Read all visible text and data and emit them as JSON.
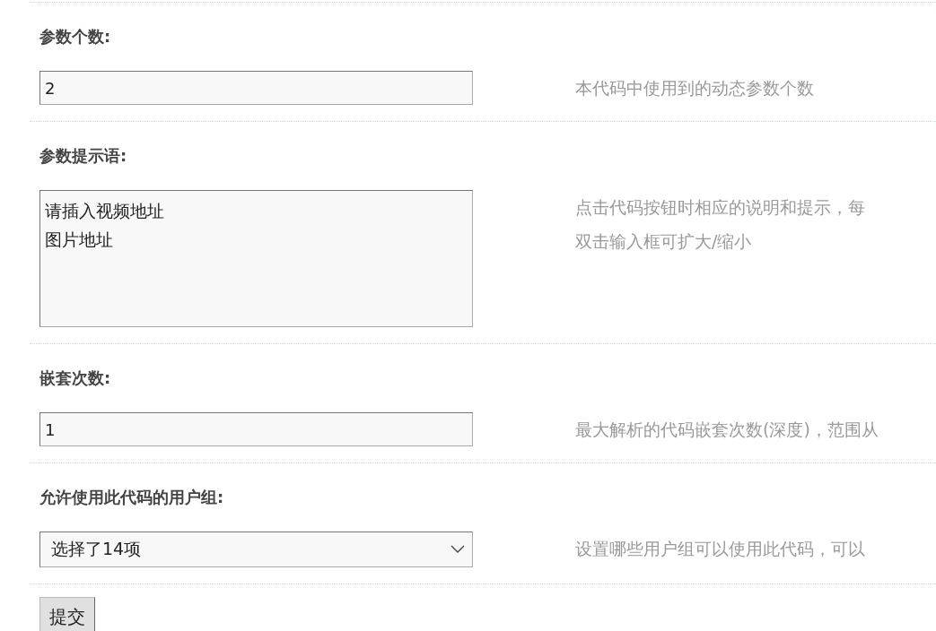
{
  "fields": [
    {
      "label": "参数个数:",
      "kind": "text",
      "value": "2",
      "description": [
        "本代码中使用到的动态参数个数"
      ]
    },
    {
      "label": "参数提示语:",
      "kind": "textarea",
      "lines": [
        "请插入视频地址",
        "图片地址"
      ],
      "description": [
        "点击代码按钮时相应的说明和提示，每",
        "双击输入框可扩大/缩小"
      ]
    },
    {
      "label": "嵌套次数:",
      "kind": "text",
      "value": "1",
      "description": [
        "最大解析的代码嵌套次数(深度)，范围从"
      ]
    },
    {
      "label": "允许使用此代码的用户组:",
      "kind": "select",
      "value": "选择了14项",
      "description": [
        "设置哪些用户组可以使用此代码，可以"
      ]
    }
  ],
  "submit": "提交"
}
